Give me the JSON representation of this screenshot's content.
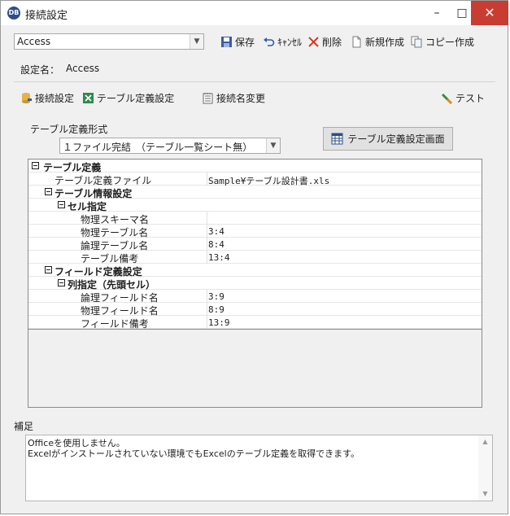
{
  "window": {
    "title": "接続設定",
    "icon_text": "DB",
    "minimize": "–",
    "maximize": "□",
    "close": "✕"
  },
  "connection_select": {
    "value": "Access"
  },
  "toolbar": {
    "save": "保存",
    "cancel": "ｷｬﾝｾﾙ",
    "delete": "削除",
    "new": "新規作成",
    "copy": "コピー作成"
  },
  "setting_name": {
    "label": "設定名：",
    "value": "Access"
  },
  "tabs": {
    "connection": "接続設定",
    "table_def": "テーブル定義設定",
    "rename": "接続名変更",
    "test": "テスト"
  },
  "table_format": {
    "label": "テーブル定義形式",
    "value": "１ファイル完結　（テーブル一覧シート無）",
    "button": "テーブル定義設定画面"
  },
  "grid": {
    "rows": [
      {
        "name": "テーブル定義",
        "value": "",
        "kind": "cat"
      },
      {
        "name": "テーブル定義ファイル",
        "value": "Sample¥テーブル設計書.xls",
        "kind": "prop"
      },
      {
        "name": "テーブル情報設定",
        "value": "",
        "kind": "cat"
      },
      {
        "name": "セル指定",
        "value": "",
        "kind": "cat"
      },
      {
        "name": "物理スキーマ名",
        "value": "",
        "kind": "prop"
      },
      {
        "name": "物理テーブル名",
        "value": "3:4",
        "kind": "prop"
      },
      {
        "name": "論理テーブル名",
        "value": "8:4",
        "kind": "prop"
      },
      {
        "name": "テーブル備考",
        "value": "13:4",
        "kind": "prop"
      },
      {
        "name": "フィールド定義設定",
        "value": "",
        "kind": "cat"
      },
      {
        "name": "列指定（先頭セル）",
        "value": "",
        "kind": "cat"
      },
      {
        "name": "論理フィールド名",
        "value": "3:9",
        "kind": "prop"
      },
      {
        "name": "物理フィールド名",
        "value": "8:9",
        "kind": "prop"
      },
      {
        "name": "フィールド備考",
        "value": "13:9",
        "kind": "prop"
      }
    ]
  },
  "memo": {
    "label": "補足",
    "lines": [
      "Officeを使用しません。",
      " Excelがインストールされていない環境でもExcelのテーブル定義を取得できます。"
    ]
  }
}
